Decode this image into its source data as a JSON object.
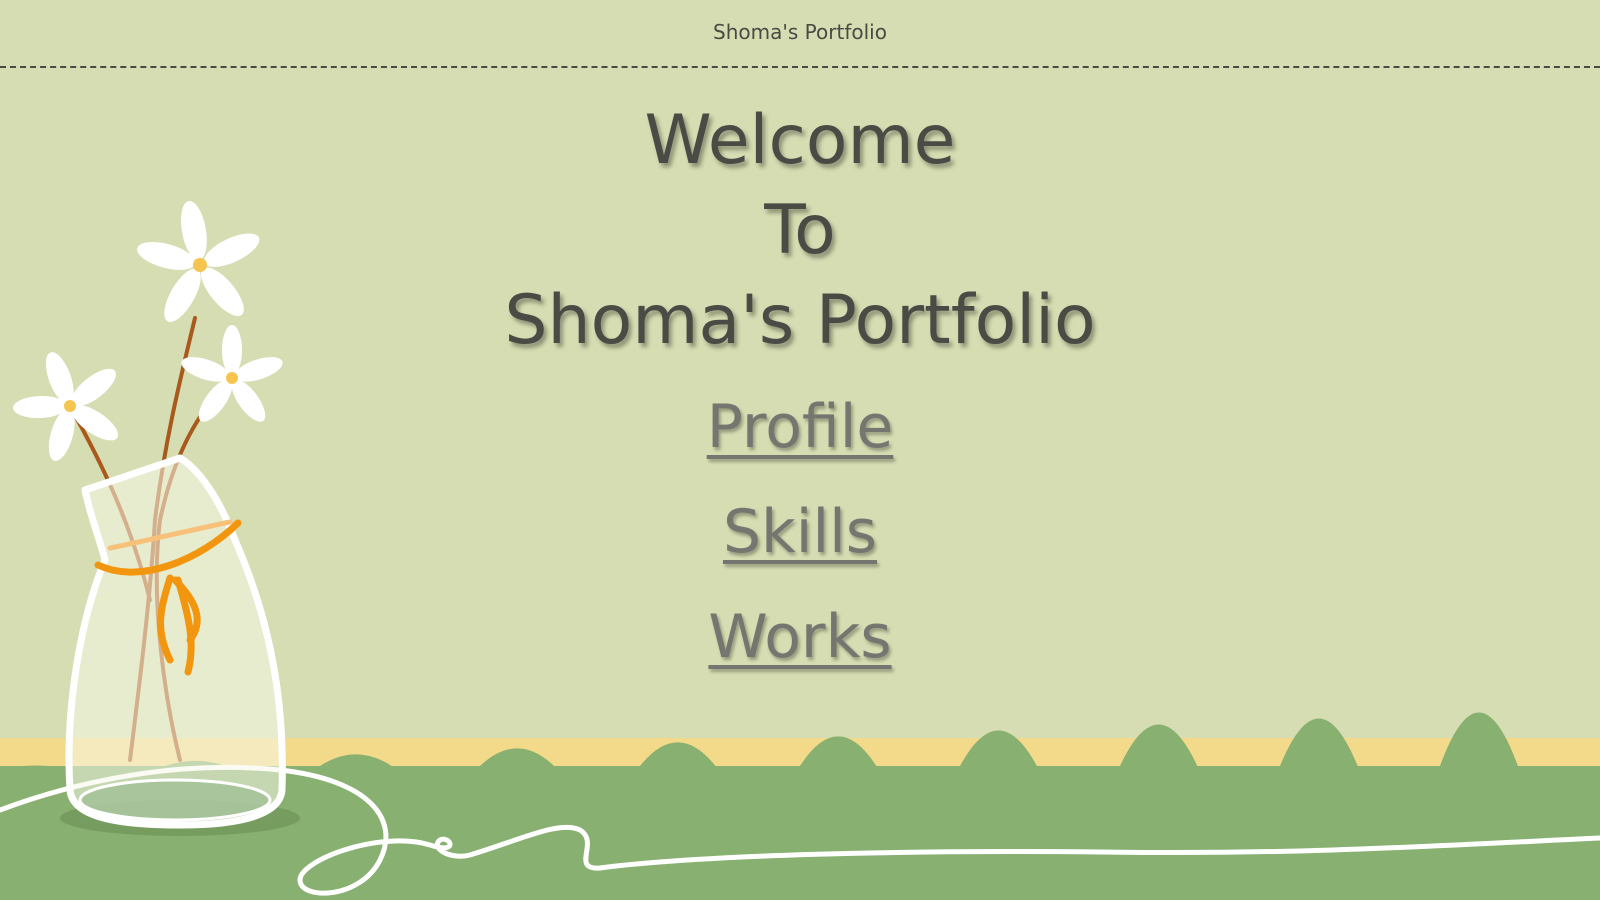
{
  "header": {
    "title": "Shoma's Portfolio"
  },
  "hero": {
    "line1": "Welcome",
    "line2": "To",
    "line3": "Shoma's Portfolio"
  },
  "nav": {
    "items": [
      {
        "label": "Profile"
      },
      {
        "label": "Skills"
      },
      {
        "label": "Works"
      }
    ]
  },
  "colors": {
    "background": "#d6ddb2",
    "table_top": "#88b070",
    "table_edge": "#f3d98a",
    "vase_ribbon": "#f2960f",
    "text": "#4a4a44"
  },
  "decorations": {
    "vase_icon": "flower-vase-icon",
    "flower_icon": "daisy-flower-icon",
    "cord_icon": "cord-line-icon"
  }
}
